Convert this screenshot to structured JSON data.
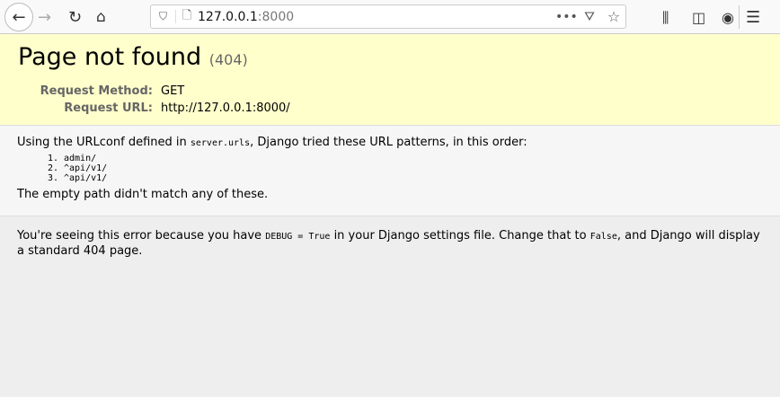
{
  "browser": {
    "url_host": "127.0.0.1",
    "url_port": ":8000"
  },
  "summary": {
    "title": "Page not found",
    "status": "(404)",
    "method_label": "Request Method:",
    "method": "GET",
    "url_label": "Request URL:",
    "url": "http://127.0.0.1:8000/"
  },
  "info": {
    "intro_before": "Using the URLconf defined in ",
    "urlconf": "server.urls",
    "intro_after": ", Django tried these URL patterns, in this order:",
    "patterns": [
      "admin/",
      "^api/v1/",
      "^api/v1/"
    ],
    "no_match": "The empty path didn't match any of these."
  },
  "explanation": {
    "before": "You're seeing this error because you have ",
    "debug_code": "DEBUG = True",
    "middle": " in your Django settings file. Change that to ",
    "false_code": "False",
    "after": ", and Django will display a standard 404 page."
  }
}
